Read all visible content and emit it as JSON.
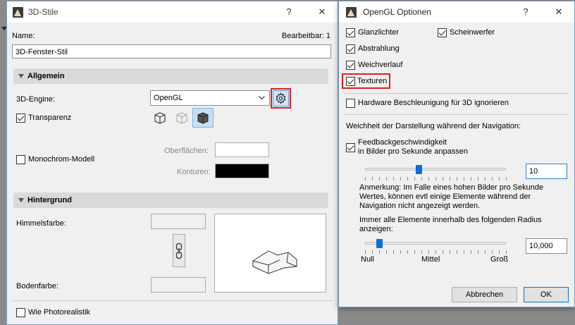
{
  "left_window": {
    "title": "3D-Stile",
    "help_glyph": "?",
    "close_glyph": "✕",
    "name_label": "Name:",
    "editable_label": "Bearbeitbar: 1",
    "name_value": "3D-Fenster-Stil",
    "section_general": "Allgemein",
    "engine_label": "3D-Engine:",
    "engine_value": "OpenGL",
    "transparency_label": "Transparenz",
    "monochrome_label": "Monochrom-Modell",
    "surfaces_label": "Oberflächen:",
    "contours_label": "Konturen:",
    "section_background": "Hintergrund",
    "sky_color_label": "Himmelsfarbe:",
    "ground_color_label": "Bodenfarbe:",
    "photorealistic_label": "Wie Photorealistik",
    "colors": {
      "surfaces": "#ffffff",
      "contours": "#000000"
    }
  },
  "right_window": {
    "title": "OpenGL Optionen",
    "help_glyph": "?",
    "close_glyph": "✕",
    "highlights_label": "Glanzlichter",
    "spotlights_label": "Scheinwerfer",
    "emission_label": "Abstrahlung",
    "soft_gradient_label": "Weichverlauf",
    "textures_label": "Texturen",
    "ignore_hw_label": "Hardware Beschleunigung für 3D ignorieren",
    "navigation_smoothness_label": "Weichheit der Darstellung während der Navigation:",
    "feedback_label_1": "Feedbackgeschwindigkeit",
    "feedback_label_2": "in Bilder pro Sekunde anpassen",
    "fps_value": "10",
    "note_1": "Anmerkung: Im Falle eines hohen Bilder pro Sekunde",
    "note_2": "Wertes, können evtl einige Elemente während der",
    "note_3": "Navigation nicht angezeigt werden.",
    "radius_label_1": "Immer alle Elemente innerhalb des folgenden Radius",
    "radius_label_2": "anzeigen:",
    "radius_value": "10,000",
    "scale_null": "Null",
    "scale_mid": "Mittel",
    "scale_max": "Groß",
    "cancel_label": "Abbrechen",
    "ok_label": "OK",
    "fps_slider_level": 0.38,
    "radius_slider_level": 0.1
  }
}
